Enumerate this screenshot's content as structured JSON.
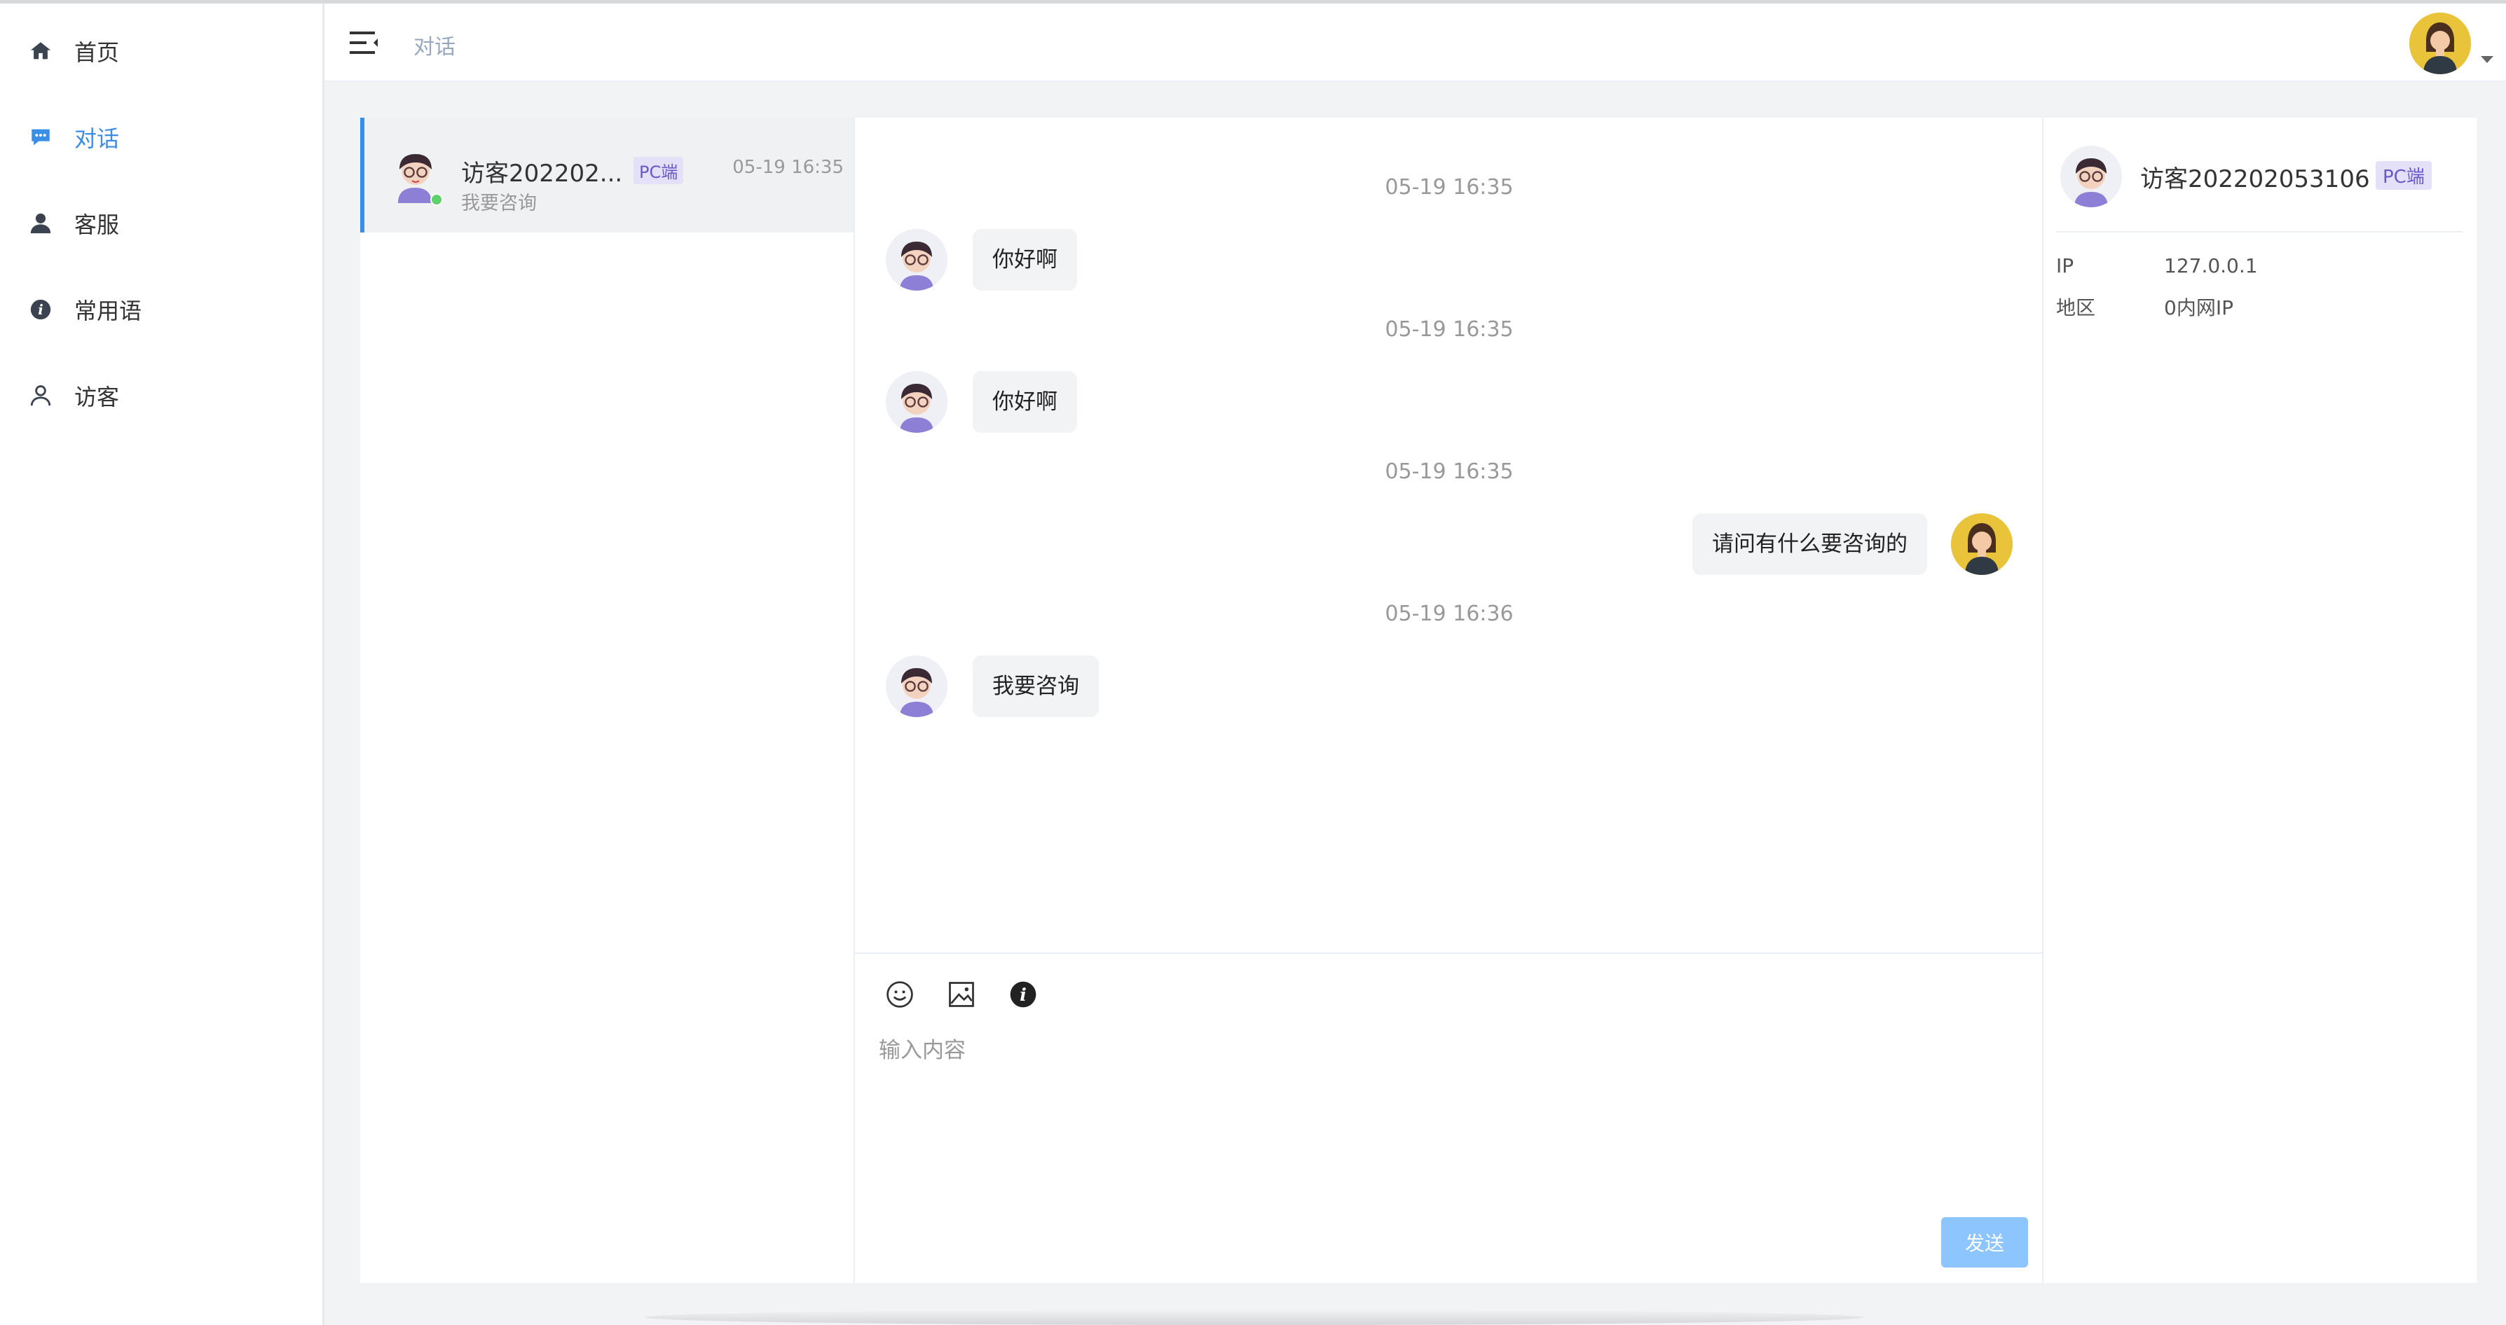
{
  "sidebar": {
    "items": [
      {
        "label": "首页",
        "icon": "home-icon"
      },
      {
        "label": "对话",
        "icon": "chat-icon",
        "active": true
      },
      {
        "label": "客服",
        "icon": "person-icon"
      },
      {
        "label": "常用语",
        "icon": "info-icon"
      },
      {
        "label": "访客",
        "icon": "user-outline-icon"
      }
    ]
  },
  "header": {
    "breadcrumb": "对话",
    "accent": "#3a8ee6"
  },
  "conversation_list": {
    "items": [
      {
        "name": "访客202202...",
        "tag": "PC端",
        "time": "05-19 16:35",
        "preview": "我要咨询",
        "online": true
      }
    ]
  },
  "chat": {
    "messages": [
      {
        "time": "05-19 16:35",
        "side": "left",
        "text": "你好啊"
      },
      {
        "time": "05-19 16:35",
        "side": "left",
        "text": "你好啊"
      },
      {
        "time": "05-19 16:35",
        "side": "right",
        "text": "请问有什么要咨询的"
      },
      {
        "time": "05-19 16:36",
        "side": "left",
        "text": "我要咨询"
      }
    ],
    "composer": {
      "placeholder": "输入内容",
      "send_label": "发送",
      "tools": [
        "emoji-icon",
        "image-icon",
        "info-icon"
      ]
    }
  },
  "visitor_info": {
    "name": "访客202202053106",
    "tag": "PC端",
    "fields": [
      {
        "label": "IP",
        "value": "127.0.0.1"
      },
      {
        "label": "地区",
        "value": "0内网IP"
      }
    ]
  }
}
